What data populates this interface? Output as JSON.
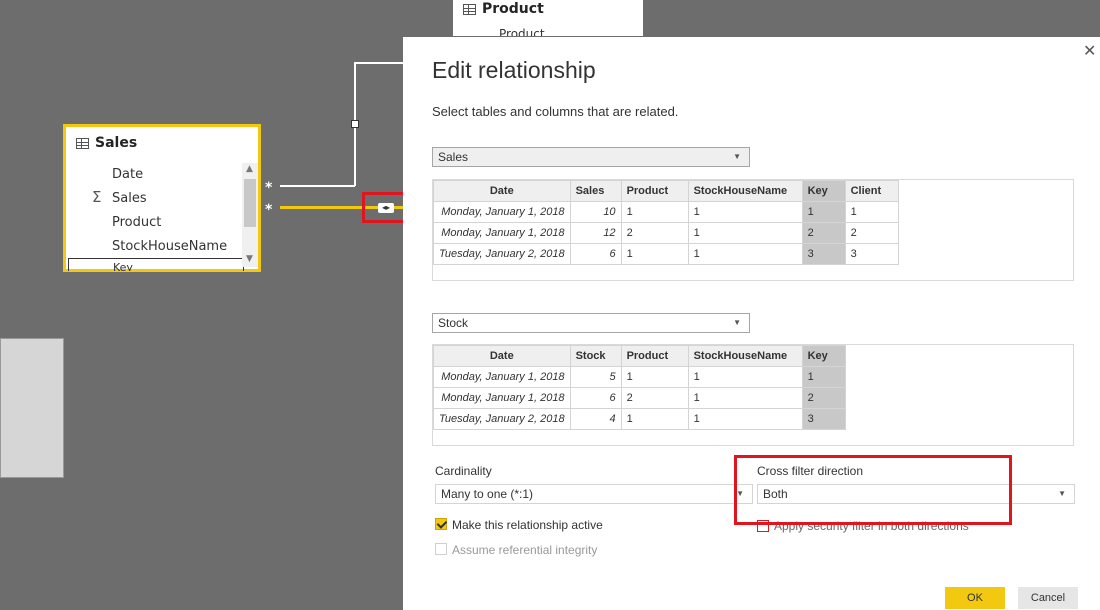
{
  "canvas": {
    "sales_table": {
      "title": "Sales",
      "fields": [
        "Date",
        "Sales",
        "Product",
        "StockHouseName",
        "Key"
      ]
    },
    "product_table": {
      "title": "Product",
      "first_field": "Product"
    },
    "connector_marks": [
      "*",
      "*"
    ]
  },
  "dialog": {
    "title": "Edit relationship",
    "subtitle": "Select tables and columns that are related.",
    "table1": {
      "name": "Sales",
      "columns": [
        "Date",
        "Sales",
        "Product",
        "StockHouseName",
        "Key",
        "Client"
      ],
      "rows": [
        [
          "Monday, January 1, 2018",
          "10",
          "1",
          "1",
          "1",
          "1"
        ],
        [
          "Monday, January 1, 2018",
          "12",
          "2",
          "1",
          "2",
          "2"
        ],
        [
          "Tuesday, January 2, 2018",
          "6",
          "1",
          "1",
          "3",
          "3"
        ]
      ],
      "selected_column": "Key"
    },
    "table2": {
      "name": "Stock",
      "columns": [
        "Date",
        "Stock",
        "Product",
        "StockHouseName",
        "Key"
      ],
      "rows": [
        [
          "Monday, January 1, 2018",
          "5",
          "1",
          "1",
          "1"
        ],
        [
          "Monday, January 1, 2018",
          "6",
          "2",
          "1",
          "2"
        ],
        [
          "Tuesday, January 2, 2018",
          "4",
          "1",
          "1",
          "3"
        ]
      ],
      "selected_column": "Key"
    },
    "cardinality": {
      "label": "Cardinality",
      "value": "Many to one (*:1)"
    },
    "cross_filter": {
      "label": "Cross filter direction",
      "value": "Both"
    },
    "make_active": {
      "label": "Make this relationship active",
      "checked": true
    },
    "security_filter": {
      "label": "Apply security filter in both directions",
      "checked": false
    },
    "referential_integrity": {
      "label": "Assume referential integrity",
      "checked": false
    },
    "ok_label": "OK",
    "cancel_label": "Cancel"
  },
  "colors": {
    "accent": "#f2c811",
    "highlight_red": "#e0151d",
    "canvas_bg": "#6d6d6d"
  }
}
